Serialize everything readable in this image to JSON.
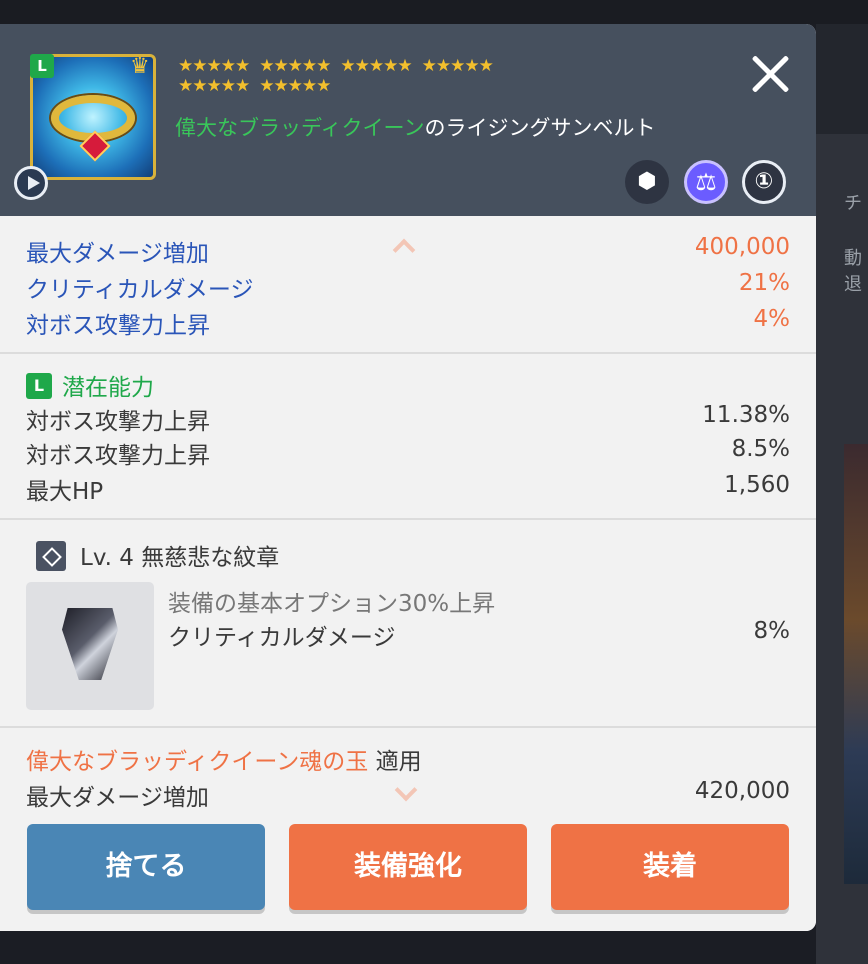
{
  "item": {
    "stars": [
      "★★★★★",
      "★★★★★",
      "★★★★★",
      "★★★★★",
      "★★★★★",
      "★★★★★"
    ],
    "grade_badge": "L",
    "name_highlight": "偉大なブラッディクイーン",
    "name_rest": "のライジングサンベルト",
    "tag_icons": [
      "lock-icon",
      "balance-icon",
      "upgrade-1-icon"
    ],
    "tag_glyphs": [
      "⬢",
      "⚖",
      "①"
    ]
  },
  "main_stats": [
    {
      "label": "最大ダメージ増加",
      "value": "400,000"
    },
    {
      "label": "クリティカルダメージ",
      "value": "21%"
    },
    {
      "label": "対ボス攻撃力上昇",
      "value": "4%"
    }
  ],
  "potential": {
    "badge": "L",
    "title": "潜在能力",
    "lines": [
      {
        "label": "対ボス攻撃力上昇",
        "value": "11.38%"
      },
      {
        "label": "対ボス攻撃力上昇",
        "value": "8.5%"
      },
      {
        "label": "最大HP",
        "value": "1,560"
      }
    ]
  },
  "emblem": {
    "title": "Lv. 4 無慈悲な紋章",
    "desc": "装備の基本オプション30%上昇",
    "stat_label": "クリティカルダメージ",
    "stat_value": "8%"
  },
  "soul": {
    "name": "偉大なブラッディクイーン魂の玉",
    "applied": "適用",
    "stat_label": "最大ダメージ増加",
    "stat_value": "420,000"
  },
  "buttons": {
    "discard": "捨てる",
    "enhance": "装備強化",
    "equip": "装着"
  },
  "background": {
    "peek1": "チ",
    "peek2": "動退"
  },
  "colors": {
    "header_bg": "#46505e",
    "stat_blue": "#2a55b8",
    "stat_orange": "#ef7245",
    "grade_green": "#1fa84a",
    "discard_blue": "#4a86b5"
  }
}
